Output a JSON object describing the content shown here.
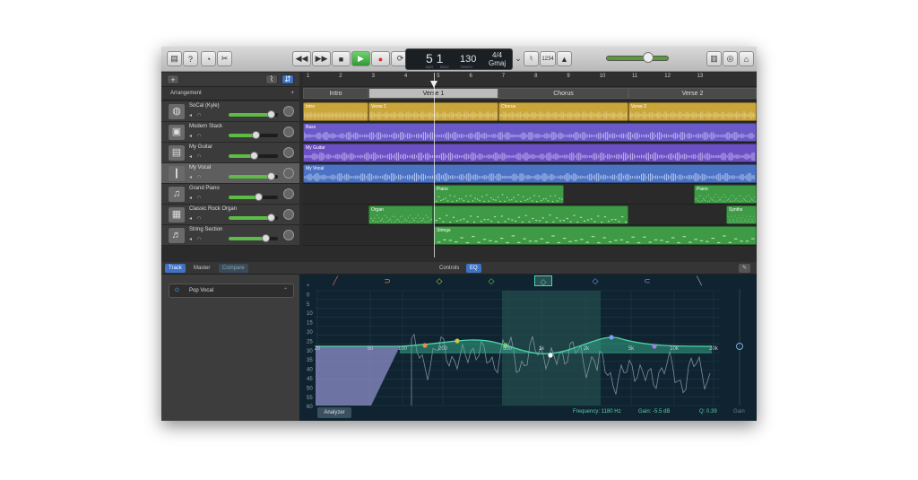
{
  "toolbar": {
    "lcd_bar": "5 1",
    "lcd_bar_sub": "BAR",
    "lcd_beat_sub": "BEAT",
    "lcd_tempo": "130",
    "lcd_tempo_sub": "TEMPO",
    "lcd_sig": "4/4",
    "lcd_key": "Gmaj",
    "count_in": "1234",
    "buttons": {
      "rewind": "◀◀",
      "forward": "▶▶",
      "stop": "■",
      "play": "▶",
      "record": "●",
      "cycle": "⟳"
    }
  },
  "arrangement": {
    "label": "Arrangement",
    "ruler": [
      "1",
      "2",
      "3",
      "4",
      "5",
      "6",
      "7",
      "8",
      "9",
      "10",
      "11",
      "12",
      "13"
    ],
    "sections": [
      "Intro",
      "Verse 1",
      "Chorus",
      "Verse 2"
    ]
  },
  "tracks": [
    {
      "name": "SoCal (Kyle)",
      "icon": "drums-icon",
      "volume": 0.85
    },
    {
      "name": "Modern Stack",
      "icon": "amp-icon",
      "volume": 0.55
    },
    {
      "name": "My Guitar",
      "icon": "guitar-amp-icon",
      "volume": 0.5
    },
    {
      "name": "My Vocal",
      "icon": "microphone-icon",
      "volume": 0.85
    },
    {
      "name": "Grand Piano",
      "icon": "piano-icon",
      "volume": 0.6
    },
    {
      "name": "Classic Rock Organ",
      "icon": "organ-icon",
      "volume": 0.85
    },
    {
      "name": "String Section",
      "icon": "strings-icon",
      "volume": 0.75
    }
  ],
  "regions": {
    "drums": [
      "Intro",
      "Verse 1",
      "Chorus",
      "Verse 2"
    ],
    "bass": "Bass",
    "guitar": "My Guitar",
    "vocal": "My Vocal",
    "piano": [
      "Piano",
      "Piano"
    ],
    "organ": [
      "Organ",
      "Synths"
    ],
    "strings": "Strings"
  },
  "lower": {
    "tabs_left": [
      "Track",
      "Master",
      "Compare"
    ],
    "tabs_center": [
      "Controls",
      "EQ"
    ],
    "preset": "Pop Vocal",
    "analyzer": "Analyzer",
    "frequency": "Frequency: 1180 Hz",
    "gain": "Gain: -5.5 dB",
    "q": "Q: 0.39",
    "gain_label": "Gain",
    "db_scale": [
      "+",
      "0",
      "5",
      "10",
      "15",
      "20",
      "25",
      "30",
      "35",
      "40",
      "45",
      "50",
      "55",
      "60"
    ],
    "freq_scale": [
      "20",
      "50",
      "100",
      "200",
      "500",
      "1k",
      "2k",
      "5k",
      "10k",
      "20k"
    ]
  },
  "colors": {
    "drums": "#c9a53a",
    "bass": "#6a5ac8",
    "guitar": "#6b50c4",
    "vocal": "#4c72c4",
    "midi": "#3e9a45",
    "accent": "#3e72c5",
    "eq_curve": "#4bd6a8"
  }
}
